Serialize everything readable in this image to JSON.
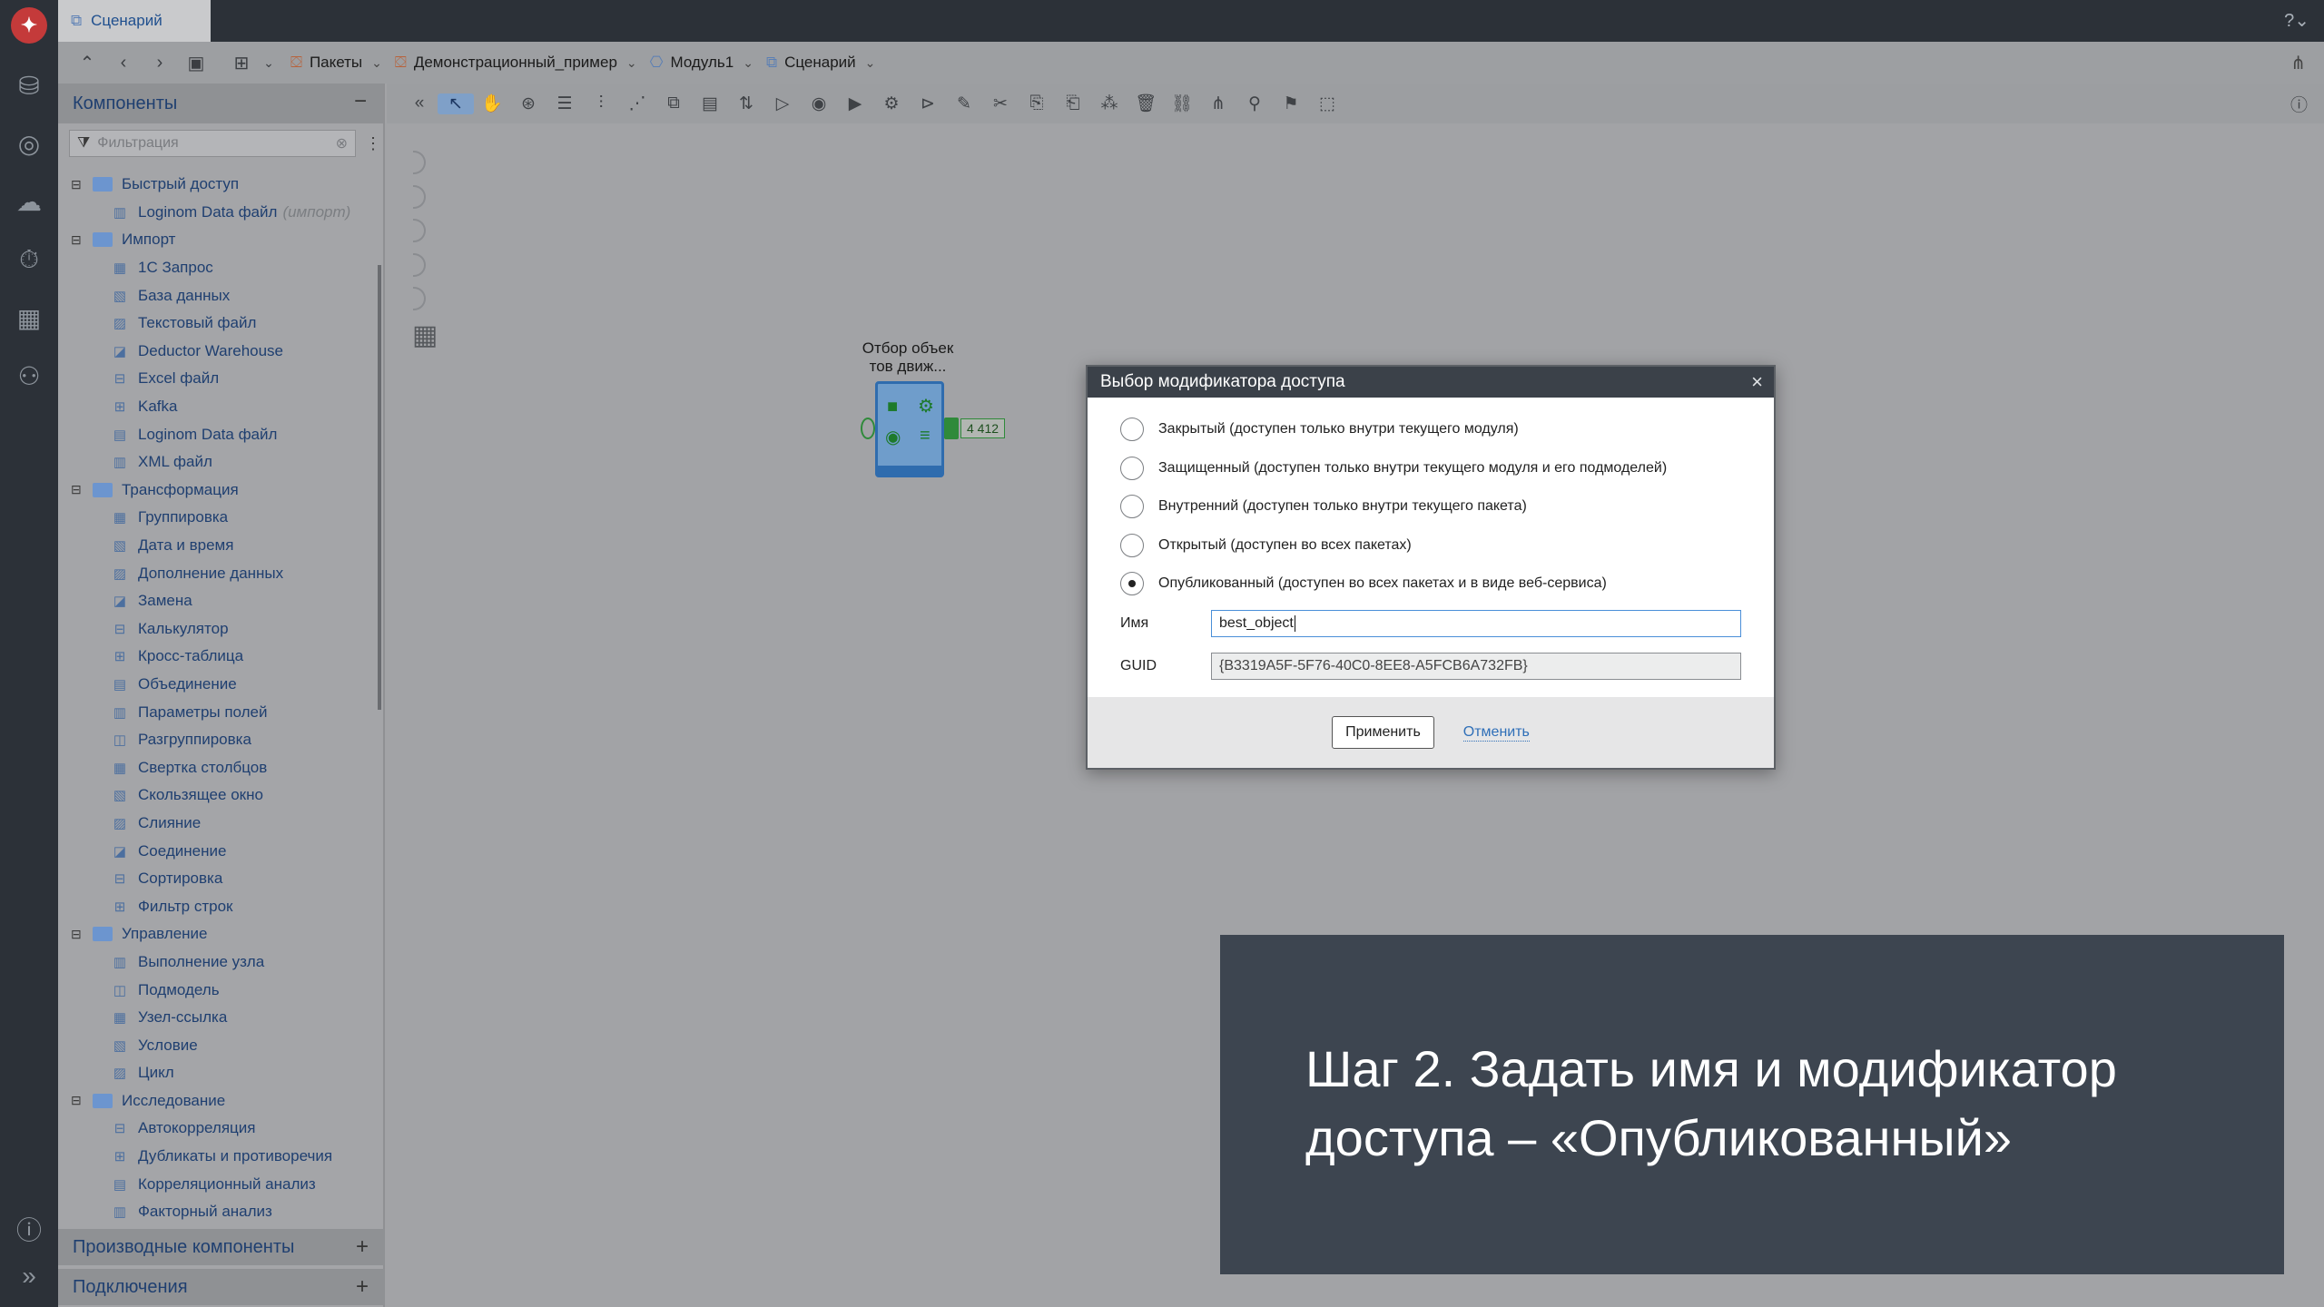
{
  "window": {
    "doc_tab": "Сценарий"
  },
  "breadcrumb": {
    "items": [
      {
        "label": "Пакеты"
      },
      {
        "label": "Демонстрационный_пример"
      },
      {
        "label": "Модуль1"
      },
      {
        "label": "Сценарий"
      }
    ]
  },
  "components_panel": {
    "title": "Компоненты",
    "filter_placeholder": "Фильтрация",
    "tree": [
      {
        "type": "group",
        "label": "Быстрый доступ"
      },
      {
        "type": "item",
        "label": "Loginom Data файл",
        "suffix": "(импорт)"
      },
      {
        "type": "group",
        "label": "Импорт"
      },
      {
        "type": "item",
        "label": "1С Запрос"
      },
      {
        "type": "item",
        "label": "База данных"
      },
      {
        "type": "item",
        "label": "Текстовый файл"
      },
      {
        "type": "item",
        "label": "Deductor Warehouse"
      },
      {
        "type": "item",
        "label": "Excel файл"
      },
      {
        "type": "item",
        "label": "Kafka"
      },
      {
        "type": "item",
        "label": "Loginom Data файл"
      },
      {
        "type": "item",
        "label": "XML файл"
      },
      {
        "type": "group",
        "label": "Трансформация"
      },
      {
        "type": "item",
        "label": "Группировка"
      },
      {
        "type": "item",
        "label": "Дата и время"
      },
      {
        "type": "item",
        "label": "Дополнение данных"
      },
      {
        "type": "item",
        "label": "Замена"
      },
      {
        "type": "item",
        "label": "Калькулятор"
      },
      {
        "type": "item",
        "label": "Кросс-таблица"
      },
      {
        "type": "item",
        "label": "Объединение"
      },
      {
        "type": "item",
        "label": "Параметры полей"
      },
      {
        "type": "item",
        "label": "Разгруппировка"
      },
      {
        "type": "item",
        "label": "Свертка столбцов"
      },
      {
        "type": "item",
        "label": "Скользящее окно"
      },
      {
        "type": "item",
        "label": "Слияние"
      },
      {
        "type": "item",
        "label": "Соединение"
      },
      {
        "type": "item",
        "label": "Сортировка"
      },
      {
        "type": "item",
        "label": "Фильтр строк"
      },
      {
        "type": "group",
        "label": "Управление"
      },
      {
        "type": "item",
        "label": "Выполнение узла"
      },
      {
        "type": "item",
        "label": "Подмодель"
      },
      {
        "type": "item",
        "label": "Узел-ссылка"
      },
      {
        "type": "item",
        "label": "Условие"
      },
      {
        "type": "item",
        "label": "Цикл"
      },
      {
        "type": "group",
        "label": "Исследование"
      },
      {
        "type": "item",
        "label": "Автокорреляция"
      },
      {
        "type": "item",
        "label": "Дубликаты и противоречия"
      },
      {
        "type": "item",
        "label": "Корреляционный анализ"
      },
      {
        "type": "item",
        "label": "Факторный анализ"
      }
    ],
    "derived_section": "Производные компоненты",
    "connections_section": "Подключения"
  },
  "node": {
    "label_line1": "Отбор объек",
    "label_line2": "тов движ...",
    "badge": "4 412"
  },
  "dialog": {
    "title": "Выбор модификатора доступа",
    "options": [
      {
        "label": "Закрытый (доступен только внутри текущего модуля)",
        "selected": false
      },
      {
        "label": "Защищенный (доступен только внутри текущего модуля и его подмоделей)",
        "selected": false
      },
      {
        "label": "Внутренний (доступен только внутри текущего пакета)",
        "selected": false
      },
      {
        "label": "Открытый (доступен во всех пакетах)",
        "selected": false
      },
      {
        "label": "Опубликованный (доступен во всех пакетах и в виде веб-сервиса)",
        "selected": true
      }
    ],
    "name_label": "Имя",
    "name_value": "best_object",
    "guid_label": "GUID",
    "guid_value": "{B3319A5F-5F76-40C0-8EE8-A5FCB6A732FB}",
    "apply_label": "Применить",
    "cancel_label": "Отменить"
  },
  "caption": {
    "line1": "Шаг 2. Задать имя и модификатор",
    "line2": "доступа – «Опубликованный»"
  },
  "colors": {
    "rail": "#2c3138",
    "dialog_title": "#3b4149",
    "caption_bg": "#3d4550",
    "link": "#2f6fb8"
  }
}
